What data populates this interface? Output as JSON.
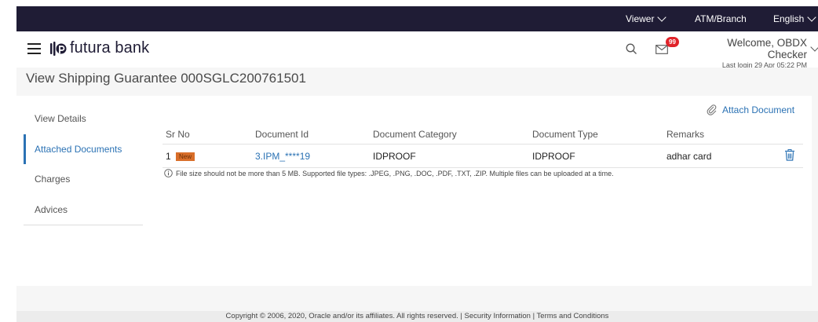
{
  "topbar": {
    "viewer_label": "Viewer",
    "atm_branch_label": "ATM/Branch",
    "language_label": "English"
  },
  "header": {
    "brand": "futura bank",
    "notification_count": "99",
    "welcome": "Welcome, OBDX Checker",
    "last_login": "Last login 29 Apr 05:22 PM"
  },
  "page": {
    "title": "View Shipping Guarantee 000SGLC200761501"
  },
  "sidenav": {
    "items": [
      {
        "label": "View Details"
      },
      {
        "label": "Attached Documents"
      },
      {
        "label": "Charges"
      },
      {
        "label": "Advices"
      }
    ]
  },
  "attach_label": "Attach Document",
  "table": {
    "headers": [
      "Sr No",
      "Document Id",
      "Document Category",
      "Document Type",
      "Remarks"
    ],
    "rows": [
      {
        "sr": "1",
        "tag": "New",
        "doc_id": "3.IPM_****19",
        "category": "IDPROOF",
        "type": "IDPROOF",
        "remarks": "adhar card"
      }
    ]
  },
  "note": "File size should not be more than 5 MB. Supported file types: .JPEG, .PNG, .DOC, .PDF, .TXT, .ZIP. Multiple files can be uploaded at a time.",
  "footer": "Copyright © 2006, 2020, Oracle and/or its affiliates. All rights reserved. | Security Information | Terms and Conditions",
  "colors": {
    "topbar": "#1f1c35",
    "accent": "#2b72b4",
    "badge": "#e0232a",
    "new_tag": "#d96e29"
  }
}
